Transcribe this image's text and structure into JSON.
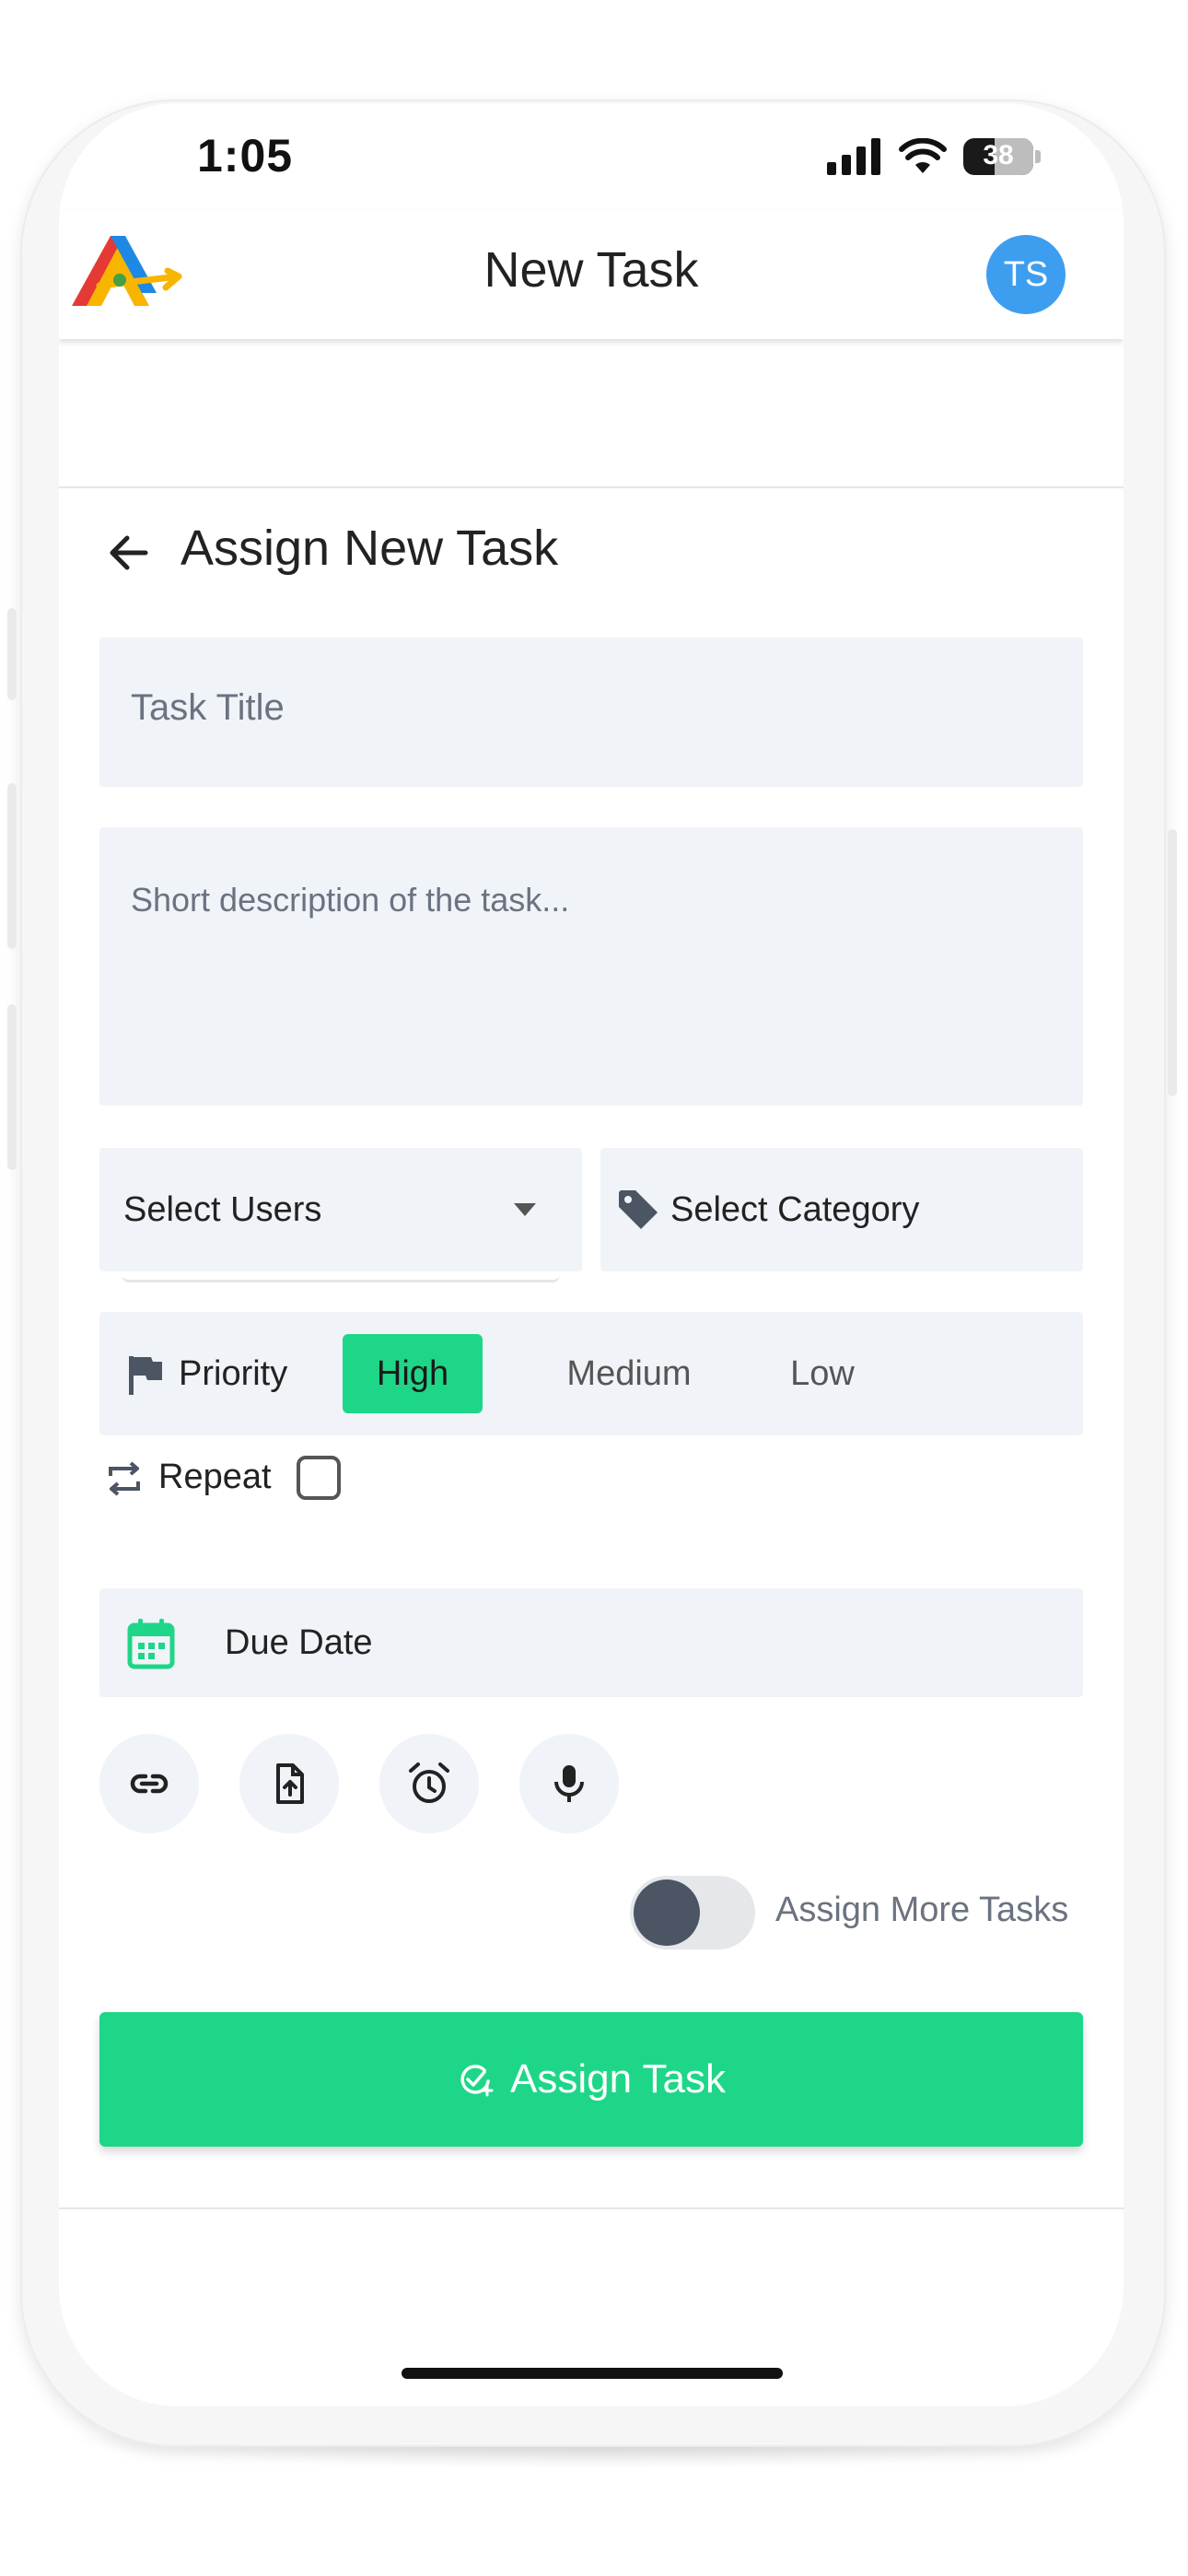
{
  "status_bar": {
    "time": "1:05",
    "battery": "38"
  },
  "header": {
    "title": "New Task",
    "avatar_initials": "TS"
  },
  "form": {
    "title": "Assign New Task",
    "task_title_placeholder": "Task Title",
    "description_placeholder": "Short description of the task...",
    "select_users": "Select Users",
    "select_category": "Select Category",
    "priority": {
      "label": "Priority",
      "options": [
        "High",
        "Medium",
        "Low"
      ],
      "selected": "High"
    },
    "repeat_label": "Repeat",
    "repeat_checked": false,
    "due_date_label": "Due Date",
    "attachments": [
      "link-icon",
      "file-upload-icon",
      "alarm-icon",
      "microphone-icon"
    ],
    "assign_more_label": "Assign More Tasks",
    "assign_more_enabled": false,
    "submit_label": "Assign Task"
  },
  "colors": {
    "accent": "#1ED688",
    "avatar": "#3D9EF0",
    "field_bg": "#F0F3F7"
  }
}
